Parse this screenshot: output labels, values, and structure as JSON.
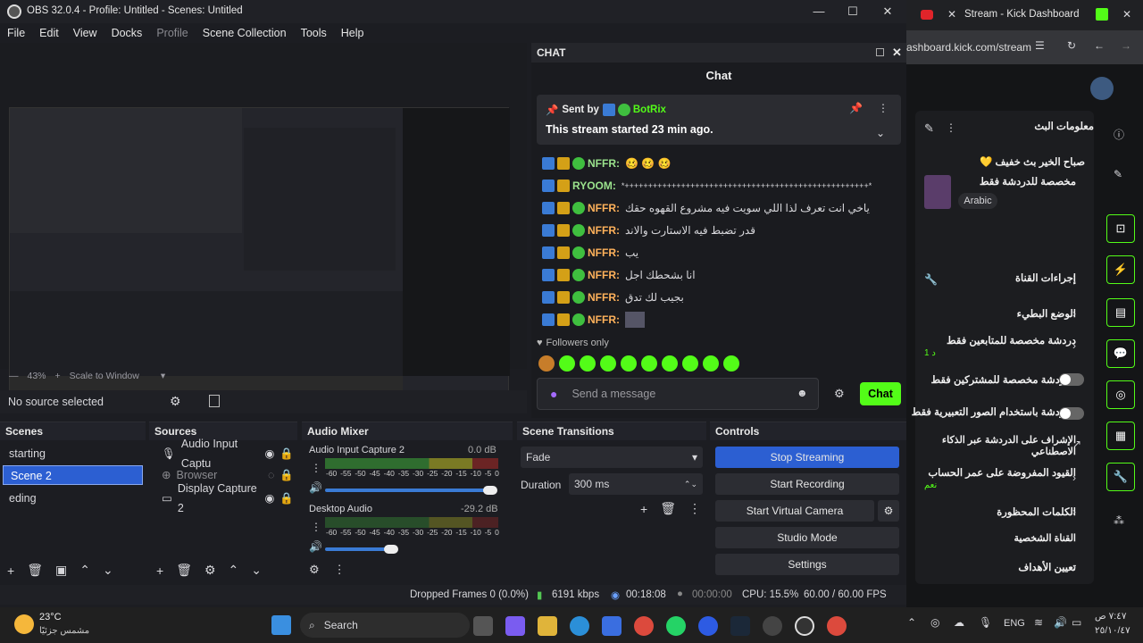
{
  "obs": {
    "title": "OBS 32.0.4 - Profile: Untitled - Scenes: Untitled",
    "menu": [
      "File",
      "Edit",
      "View",
      "Docks",
      "Profile",
      "Scene Collection",
      "Tools",
      "Help"
    ],
    "zoom": "43%",
    "zoom_mode": "Scale to Window",
    "no_source": "No source selected",
    "scenes": {
      "title": "Scenes",
      "items": [
        "starting",
        "Scene 2",
        "eding"
      ],
      "selected": 1
    },
    "sources": {
      "title": "Sources",
      "items": [
        "Audio Input Captu",
        "Browser",
        "Display Capture 2"
      ]
    },
    "mixer": {
      "title": "Audio Mixer",
      "channels": [
        {
          "name": "Audio Input Capture 2",
          "db": "0.0 dB"
        },
        {
          "name": "Desktop Audio",
          "db": "-29.2 dB"
        }
      ],
      "ticks": [
        "-60",
        "-55",
        "-50",
        "-45",
        "-40",
        "-35",
        "-30",
        "-25",
        "-20",
        "-15",
        "-10",
        "-5",
        "0"
      ]
    },
    "transitions": {
      "title": "Scene Transitions",
      "type": "Fade",
      "duration_label": "Duration",
      "duration": "300 ms"
    },
    "controls": {
      "title": "Controls",
      "buttons": [
        "Stop Streaming",
        "Start Recording",
        "Start Virtual Camera",
        "Studio Mode",
        "Settings"
      ]
    },
    "status": {
      "dropped": "Dropped Frames 0 (0.0%)",
      "bitrate": "6191 kbps",
      "live": "00:18:08",
      "rec": "00:00:00",
      "cpu": "CPU: 15.5%",
      "fps": "60.00 / 60.00 FPS"
    }
  },
  "chat": {
    "dock_title": "CHAT",
    "title": "Chat",
    "pinned": {
      "label": "Sent by",
      "user": "BotRix",
      "text": "This stream started 23 min ago."
    },
    "messages": [
      {
        "user": "NFFR:",
        "text": "🥴 🥴 🥴"
      },
      {
        "user": "RYOOM:",
        "text": "*++++++++++++++++++++++++++++++++++++++++++++++++++++*"
      },
      {
        "user": "NFFR:",
        "text": "ياخي انت تعرف لذا اللي سويت فيه مشروع القهوه حقك"
      },
      {
        "user": "NFFR:",
        "text": "قدر تضبط فيه الاستارت والاند"
      },
      {
        "user": "NFFR:",
        "text": "يب"
      },
      {
        "user": "NFFR:",
        "text": "انا بشحطك اجل"
      },
      {
        "user": "NFFR:",
        "text": "بجيب لك تدق"
      },
      {
        "user": "NFFR:",
        "text": ""
      }
    ],
    "followers_only": "Followers only",
    "send_placeholder": "Send a message",
    "chat_button": "Chat"
  },
  "browser": {
    "tab": "Stream - Kick Dashboard",
    "url": "ashboard.kick.com/stream",
    "stream_info": "معلومات البث",
    "greeting": "صباح الخير بث خفيف 💛",
    "category": "مخصصة للدردشة فقط",
    "lang": "Arabic",
    "channel_actions": "إجراءات القناة",
    "rows": [
      "الوضع البطيء",
      "دردشة مخصصة للمتابعين فقط",
      "الدردشة مخصصة للمشتركين فقط",
      "الدردشة باستخدام الصور التعبيرية فقط",
      "الإشراف على الدردشة عبر الذكاء الاصطناعي",
      "القيود المفروضة على عمر الحساب",
      "الكلمات المحظورة",
      "القناة الشخصية",
      "تعيين الأهداف"
    ],
    "row_sub1": "1 د",
    "row_sub2": "نعم"
  },
  "taskbar": {
    "weather": "23°C",
    "weather_sub": "مشمس جزئيًا",
    "search": "Search",
    "lang": "ENG",
    "time": "٧:٤٧ ص",
    "date": "٢٥/١٠/٤٧"
  }
}
